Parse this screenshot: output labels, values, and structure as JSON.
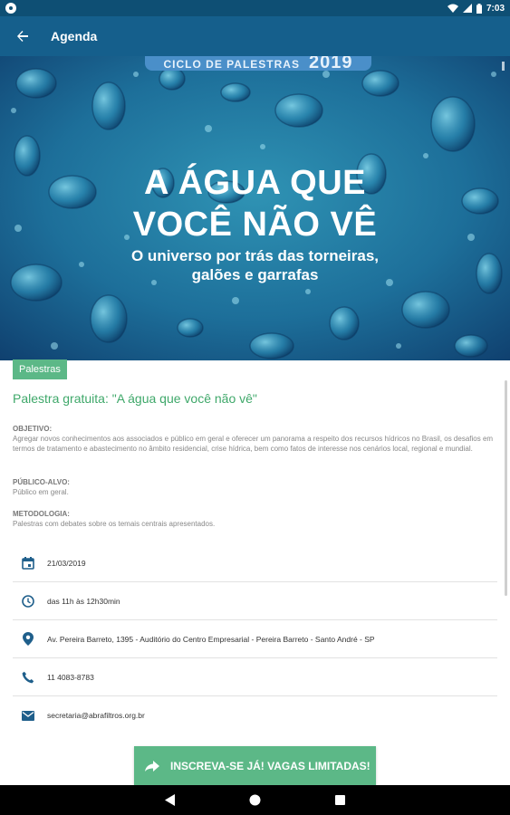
{
  "status_bar": {
    "time": "7:03"
  },
  "app_bar": {
    "title": "Agenda"
  },
  "hero": {
    "ribbon_text": "CICLO DE PALESTRAS",
    "ribbon_year": "2019",
    "title_line1": "A ÁGUA QUE",
    "title_line2": "VOCÊ NÃO VÊ",
    "subtitle_line1": "O universo por trás das torneiras,",
    "subtitle_line2": "galões e garrafas"
  },
  "category_tag": "Palestras",
  "event_title": "Palestra gratuita: \"A água que você não vê\"",
  "sections": [
    {
      "label": "OBJETIVO:",
      "text": "Agregar novos conhecimentos aos associados e público em geral e oferecer um panorama a respeito dos recursos hídricos no Brasil, os desafios em termos de tratamento e abastecimento no âmbito residencial, crise hídrica, bem como fatos de interesse nos cenários local, regional e mundial."
    },
    {
      "label": "PÚBLICO-ALVO:",
      "text": "Público em geral."
    },
    {
      "label": "METODOLOGIA:",
      "text": "Palestras com debates sobre os temais centrais apresentados."
    }
  ],
  "info": {
    "date": "21/03/2019",
    "time": "das 11h às 12h30min",
    "address": "Av. Pereira Barreto, 1395 - Auditório do Centro Empresarial - Pereira Barreto - Santo André - SP",
    "phone": "11 4083-8783",
    "email": "secretaria@abrafiltros.org.br"
  },
  "icons": {
    "date": "calendar-icon",
    "time": "clock-icon",
    "address": "location-pin-icon",
    "phone": "phone-icon",
    "email": "email-icon"
  },
  "cta_label": "INSCREVA-SE JÁ! VAGAS LIMITADAS!",
  "colors": {
    "status_bar": "#0e4f74",
    "app_bar": "#155f8c",
    "accent_green": "#5cb887",
    "title_green": "#3fa86a",
    "icon_blue": "#1f5f8b"
  }
}
